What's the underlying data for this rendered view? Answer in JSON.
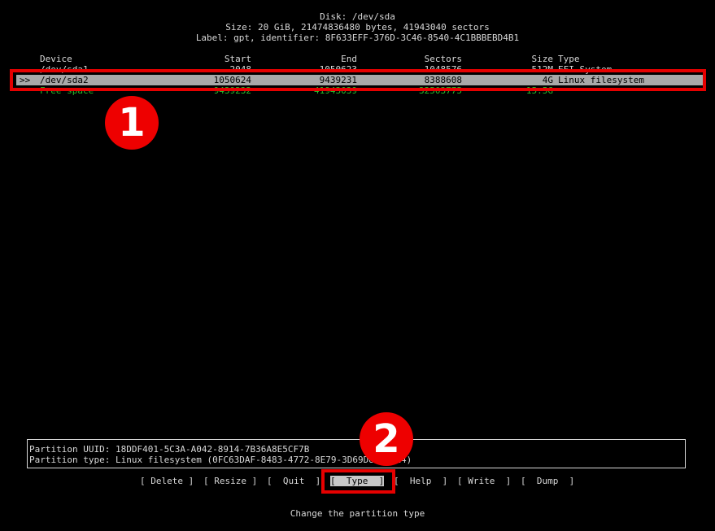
{
  "header": {
    "disk": "Disk: /dev/sda",
    "size": "Size: 20 GiB, 21474836480 bytes, 41943040 sectors",
    "label": "Label: gpt, identifier: 8F633EFF-376D-3C46-8540-4C1BBBEBD4B1"
  },
  "columns": {
    "device": "Device",
    "start": "Start",
    "end": "End",
    "sectors": "Sectors",
    "size": "Size",
    "type": "Type"
  },
  "partitions": [
    {
      "marker": "",
      "device": "/dev/sda1",
      "start": "2048",
      "end": "1050623",
      "sectors": "1048576",
      "size": "512M",
      "type": "EFI System"
    },
    {
      "marker": ">>",
      "device": "/dev/sda2",
      "start": "1050624",
      "end": "9439231",
      "sectors": "8388608",
      "size": "4G",
      "type": "Linux filesystem"
    },
    {
      "marker": "",
      "device": "Free space",
      "start": "9439232",
      "end": "41943039",
      "sectors": "32503775",
      "size": "15.5G",
      "type": ""
    }
  ],
  "info": {
    "uuid": "Partition UUID: 18DDF401-5C3A-A042-8914-7B36A8E5CF7B",
    "type": "Partition type: Linux filesystem (0FC63DAF-8483-4772-8E79-3D69D8477DE4)"
  },
  "buttons": {
    "delete": "[ Delete ]",
    "resize": "[ Resize ]",
    "quit": "[  Quit  ]",
    "type": "[  Type  ]",
    "help": "[  Help  ]",
    "write": "[ Write  ]",
    "dump": "[  Dump  ]"
  },
  "status": "Change the partition type",
  "annotations": {
    "step1": "1",
    "step2": "2",
    "highlight_color": "#e60000"
  },
  "colors": {
    "background": "#000000",
    "text": "#d8d8d8",
    "selection": "#a9a9a9",
    "free_space": "#2bbd2b"
  }
}
